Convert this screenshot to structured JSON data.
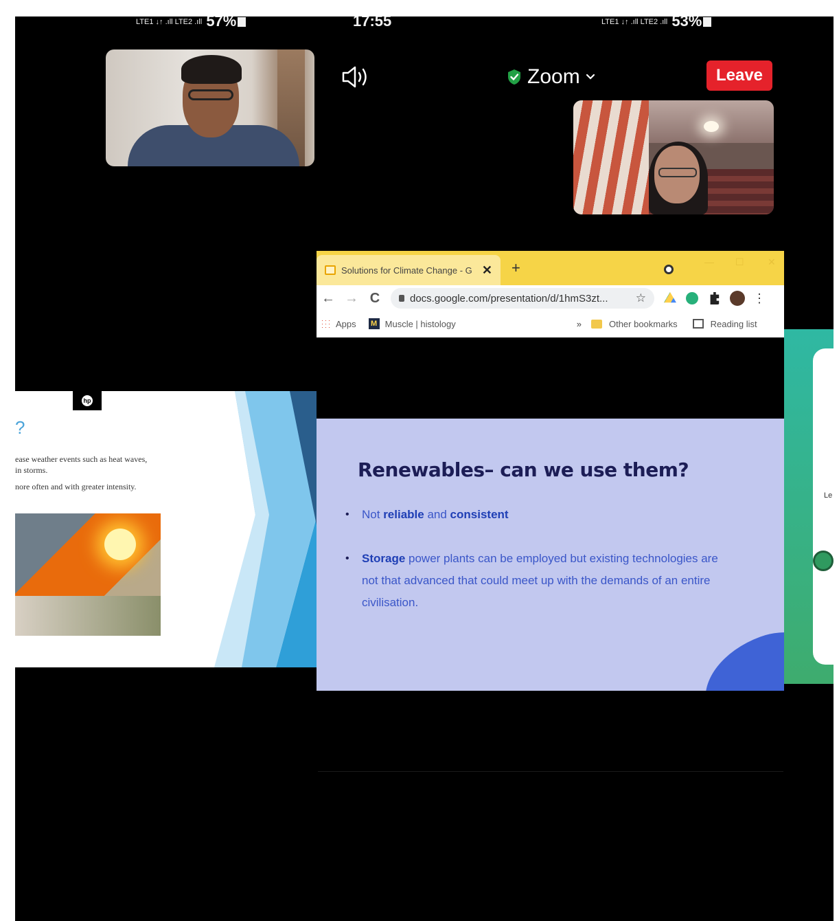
{
  "status_bar_left": {
    "signal": "LTE1 ↓↑  .ıll LTE2 .ıll",
    "battery": "57%"
  },
  "status_bar_center": {
    "time": "17:55"
  },
  "status_bar_right": {
    "signal": "LTE1 ↓↑  .ıll LTE2 .ıll",
    "battery": "53%"
  },
  "meeting": {
    "app_name": "Zoom",
    "leave_label": "Leave",
    "accent_red": "#e5222b",
    "secure_green": "#22a045"
  },
  "browser": {
    "tab_title": "Solutions for Climate Change - G",
    "address": "docs.google.com/presentation/d/1hmS3zt...",
    "bookmarks": {
      "apps": "Apps",
      "muscle": "Muscle | histology",
      "other": "Other bookmarks",
      "reading_list": "Reading list"
    },
    "tab_color": "#f6d447"
  },
  "slide": {
    "title": "Renewables– can we use them?",
    "bullet1": {
      "pre": "Not ",
      "b1": "reliable",
      "mid": " and ",
      "b2": "consistent"
    },
    "bullet2": {
      "b": "Storage",
      "rest": " power plants can be employed but existing technologies are not that advanced that could meet up with the demands of an entire civilisation."
    },
    "background": "#c2c8ef"
  },
  "left_slide": {
    "question_mark": "?",
    "line1": "ease weather events such as heat waves,",
    "line2": "in storms.",
    "line3": "nore often and with greater intensity.",
    "hp": "hp"
  },
  "right_slide": {
    "text": "Le"
  }
}
